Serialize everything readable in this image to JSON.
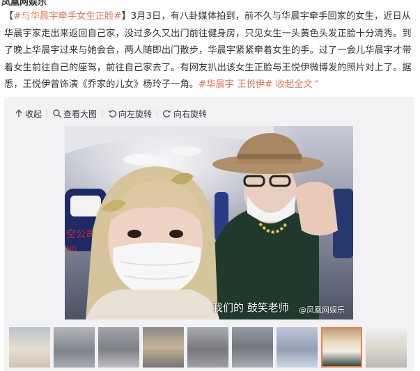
{
  "author": {
    "name": "凤凰网娱乐"
  },
  "post": {
    "lbr": "【",
    "topic": "#与华晨宇牵手女生正脸#",
    "rbr": "】",
    "body": "3月3日，有八卦媒体拍到，前不久与华晨宇牵手回家的女生，近日从华晨宇家走出来返回自己家，没过多久又出门前往健身房，只见女生一头黄色头发正脸十分清秀。到了晚上华晨宇过来与她会合，两人随即出门散步，华晨宇紧紧牵着女生的手。过了一会儿华晨宇才带着女生前往自己的座驾，前往自己家去了。有网友扒出该女生正脸与王悦伊微博发的照片对上了。据悉，王悦伊曾饰演《乔家的儿女》杨玲子一角。",
    "tag1": "#华晨宇",
    "tag2": "王悦伊#",
    "collapse": "收起全文",
    "collapse_arrow": "⌃"
  },
  "toolbar": {
    "collapse": "收起",
    "view_large": "查看大图",
    "rotate_left": "向左旋转",
    "rotate_right": "向右旋转"
  },
  "photo": {
    "caption": "我们的 鼓笑老师",
    "watermark": "@凤凰网娱乐",
    "sign_text": "空公司",
    "sign_text2": "NG"
  },
  "thumbnails": {
    "count": 9,
    "active_index": 7
  },
  "colors": {
    "link": "#eb7350",
    "active_thumb_border": "#fa7d3c",
    "toolbar_bg": "#f2f2f5"
  }
}
